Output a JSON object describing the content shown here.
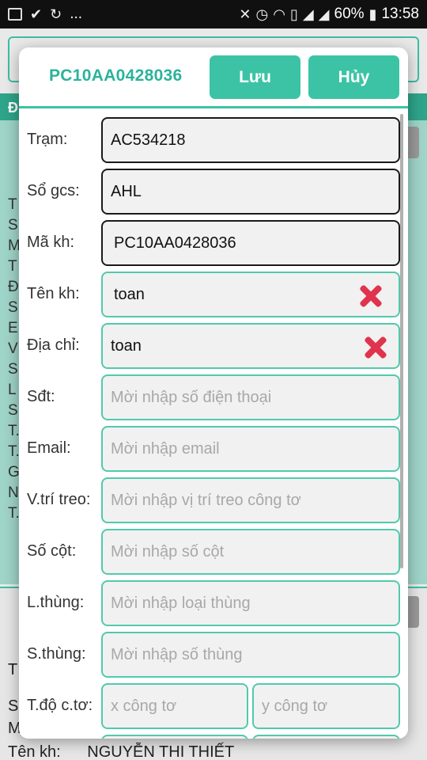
{
  "status_bar": {
    "left_icons": [
      "image-icon",
      "check-flag-icon",
      "sync-icon"
    ],
    "overflow": "...",
    "battery_percent": "60%",
    "time": "13:58",
    "right_icons": [
      "mute-icon",
      "alarm-icon",
      "wifi-icon",
      "sim1-icon",
      "signal-icon",
      "signal-icon",
      "battery-icon"
    ]
  },
  "background": {
    "band_header": "Đ",
    "side_letters": [
      "T",
      "",
      "S",
      "M",
      "T",
      "Đ",
      "S",
      "E",
      "V",
      "S",
      "L",
      "S",
      "T.",
      "T.",
      "G",
      "N",
      "T."
    ],
    "bottom_letters": [
      "T",
      "",
      "S",
      "M."
    ],
    "bottom_label": "Tên kh:",
    "bottom_value": "NGUYỄN THI THIẾT"
  },
  "dialog": {
    "title": "PC10AA0428036",
    "save_label": "Lưu",
    "cancel_label": "Hủy",
    "fields": [
      {
        "label": "Trạm:",
        "value": "AC534218",
        "placeholder": "",
        "editable": false
      },
      {
        "label": "Sổ gcs:",
        "value": "AHL",
        "placeholder": "",
        "editable": false
      },
      {
        "label": "Mã kh:",
        "value": "PC10AA0428036",
        "placeholder": "",
        "editable": false
      },
      {
        "label": "Tên kh:",
        "value": "toan",
        "placeholder": "",
        "editable": true
      },
      {
        "label": "Địa chỉ:",
        "value": "toan",
        "placeholder": "",
        "editable": true
      },
      {
        "label": "Sđt:",
        "value": "",
        "placeholder": "Mời nhập số điện thoại",
        "editable": true
      },
      {
        "label": "Email:",
        "value": "",
        "placeholder": "Mời nhập email",
        "editable": true
      },
      {
        "label": "V.trí treo:",
        "value": "",
        "placeholder": "Mời nhập vị trí treo công tơ",
        "editable": true
      },
      {
        "label": "Số cột:",
        "value": "",
        "placeholder": "Mời nhập số cột",
        "editable": true
      },
      {
        "label": "L.thùng:",
        "value": "",
        "placeholder": "Mời nhập loại thùng",
        "editable": true
      },
      {
        "label": "S.thùng:",
        "value": "",
        "placeholder": "Mời nhập số thùng",
        "editable": true
      }
    ],
    "coord_row": {
      "label": "T.độ c.tơ:",
      "x_placeholder": "x công tơ",
      "y_placeholder": "y công tơ"
    }
  },
  "colors": {
    "accent": "#3cc3a5",
    "title_text": "#2bb39a",
    "clear_icon": "#e0334d",
    "band": "#9fd4c8"
  }
}
